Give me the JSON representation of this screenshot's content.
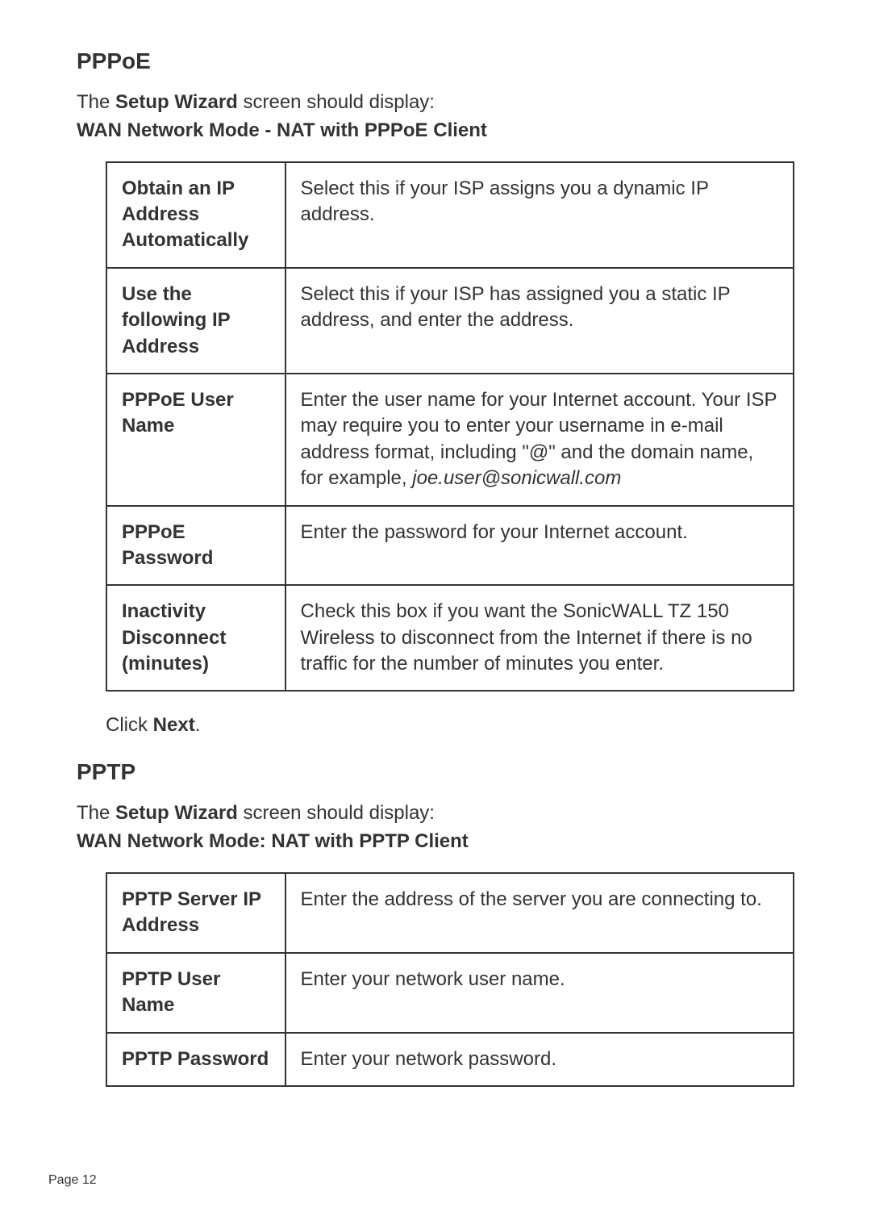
{
  "pppoe": {
    "title": "PPPoE",
    "intro_prefix": "The ",
    "intro_bold": "Setup Wizard",
    "intro_suffix": " screen should display:",
    "subtitle": "WAN Network Mode - NAT with PPPoE Client",
    "rows": [
      {
        "label": "Obtain an IP Address Automatically",
        "desc": "Select this if your ISP assigns you a dynamic IP address."
      },
      {
        "label": "Use the following IP Address",
        "desc": "Select this if your ISP has assigned you a static IP address, and enter the address."
      },
      {
        "label": "PPPoE User Name",
        "desc_part1": "Enter the user name for your Internet account. Your ISP may require you to enter your username in e-mail address format, including \"@\" and the domain name, for example, ",
        "desc_italic": "joe.user@sonicwall.com"
      },
      {
        "label": "PPPoE Password",
        "desc": "Enter the password for your Internet account."
      },
      {
        "label": "Inactivity Disconnect (minutes)",
        "desc": "Check this box if you want the SonicWALL TZ 150 Wireless to disconnect from the Internet if there is no traffic for the number of minutes you enter."
      }
    ],
    "click_prefix": "Click ",
    "click_bold": "Next",
    "click_suffix": "."
  },
  "pptp": {
    "title": "PPTP",
    "intro_prefix": "The ",
    "intro_bold": "Setup Wizard",
    "intro_suffix": " screen should display:",
    "subtitle": "WAN Network Mode: NAT with PPTP Client",
    "rows": [
      {
        "label": "PPTP Server IP Address",
        "desc": "Enter the address of the server you are connecting to."
      },
      {
        "label": "PPTP User Name",
        "desc": "Enter your network user name."
      },
      {
        "label": "PPTP Password",
        "desc": "Enter your network password."
      }
    ]
  },
  "page_number": "Page 12"
}
